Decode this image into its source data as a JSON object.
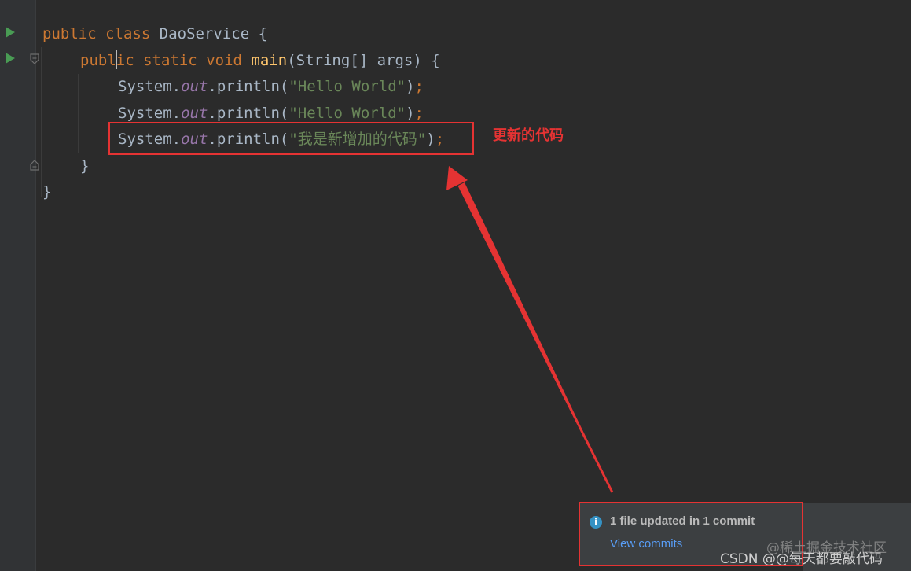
{
  "code": {
    "line1": {
      "kw1": "public",
      "kw2": "class",
      "name": "DaoService",
      "brace": "{"
    },
    "line2": {
      "kw1": "publ",
      "kw1b": "ic",
      "kw2": "static",
      "kw3": "void",
      "fn": "main",
      "args": "(String[] args) {"
    },
    "line3": {
      "obj": "System.",
      "field": "out",
      "call": ".println(",
      "str": "\"Hello World\"",
      "end": ")",
      "semi": ";"
    },
    "line4": {
      "obj": "System.",
      "field": "out",
      "call": ".println(",
      "str": "\"Hello World\"",
      "end": ")",
      "semi": ";"
    },
    "line5": {
      "obj": "System.",
      "field": "out",
      "call": ".println(",
      "str": "\"我是新增加的代码\"",
      "end": ")",
      "semi": ";"
    },
    "line6": {
      "brace": "}"
    },
    "line7": {
      "brace": "}"
    }
  },
  "annotation": {
    "text": "更新的代码",
    "color": "#e53333"
  },
  "notification": {
    "title": "1 file updated in 1 commit",
    "link": "View commits",
    "icon": "info-icon"
  },
  "watermarks": {
    "juejin": "@稀土掘金技术社区",
    "csdn": "CSDN @@每天都要敲代码"
  },
  "colors": {
    "background": "#2b2b2b",
    "keyword": "#cc7832",
    "string": "#6a8759",
    "method": "#ffc66d",
    "field": "#9876aa",
    "highlight": "#e53333",
    "link": "#589df6"
  }
}
